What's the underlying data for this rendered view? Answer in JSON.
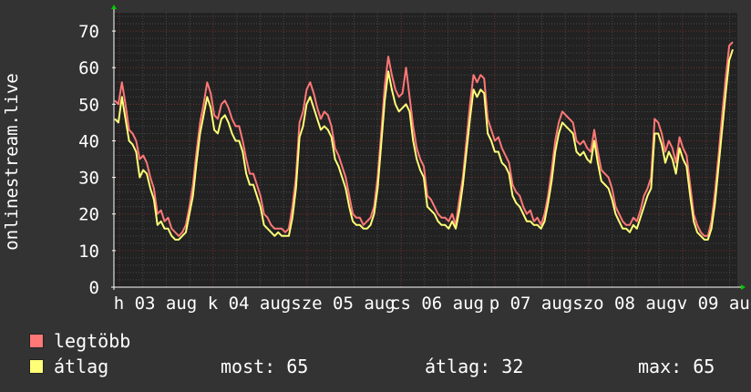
{
  "chart_data": {
    "type": "line",
    "ylabel": "onlinestream.live",
    "ylim": [
      0,
      75
    ],
    "yticks": [
      0,
      10,
      20,
      30,
      40,
      50,
      60,
      70
    ],
    "grid": true,
    "x_ticks": [
      "h 03 aug",
      "k 04 aug",
      "sze 05 aug",
      "cs 06 aug",
      "p 07 aug",
      "szo 08 aug",
      "v 09 aug"
    ],
    "series": [
      {
        "name": "legtöbb",
        "color": "#ff7777",
        "values": [
          51,
          50,
          56,
          50,
          43,
          42,
          40,
          35,
          36,
          34,
          30,
          27,
          20,
          21,
          18,
          19,
          16,
          15,
          14,
          15,
          17,
          22,
          28,
          37,
          45,
          50,
          56,
          53,
          47,
          46,
          50,
          51,
          49,
          46,
          44,
          44,
          40,
          35,
          31,
          31,
          28,
          25,
          20,
          19,
          17,
          16,
          16,
          16,
          15,
          16,
          22,
          30,
          45,
          48,
          54,
          56,
          53,
          49,
          46,
          48,
          47,
          44,
          38,
          36,
          33,
          30,
          25,
          20,
          19,
          19,
          17,
          18,
          19,
          22,
          30,
          42,
          55,
          63,
          58,
          54,
          52,
          53,
          60,
          52,
          44,
          38,
          35,
          33,
          25,
          24,
          22,
          20,
          19,
          19,
          18,
          20,
          17,
          24,
          30,
          40,
          50,
          58,
          56,
          58,
          57,
          46,
          43,
          40,
          41,
          38,
          36,
          34,
          28,
          26,
          25,
          22,
          20,
          21,
          18,
          19,
          17,
          20,
          25,
          32,
          40,
          45,
          48,
          47,
          46,
          45,
          40,
          39,
          40,
          38,
          37,
          43,
          37,
          32,
          31,
          30,
          27,
          22,
          20,
          18,
          17,
          17,
          19,
          18,
          21,
          25,
          27,
          30,
          46,
          45,
          42,
          37,
          40,
          38,
          34,
          41,
          38,
          36,
          28,
          20,
          17,
          15,
          14,
          14,
          18,
          26,
          36,
          47,
          57,
          66,
          67
        ]
      },
      {
        "name": "átlag",
        "color": "#ffff77",
        "values": [
          46,
          45,
          52,
          46,
          40,
          39,
          37,
          30,
          32,
          31,
          27,
          24,
          17,
          18,
          16,
          16,
          14,
          13,
          13,
          14,
          15,
          20,
          25,
          34,
          42,
          47,
          52,
          49,
          43,
          42,
          46,
          47,
          45,
          42,
          40,
          40,
          37,
          31,
          28,
          28,
          25,
          22,
          17,
          16,
          15,
          14,
          15,
          14,
          14,
          14,
          19,
          27,
          41,
          44,
          50,
          52,
          49,
          46,
          43,
          44,
          43,
          41,
          35,
          33,
          30,
          27,
          22,
          18,
          17,
          17,
          16,
          16,
          17,
          20,
          27,
          39,
          51,
          59,
          54,
          50,
          48,
          49,
          50,
          48,
          40,
          35,
          32,
          30,
          22,
          21,
          20,
          18,
          17,
          17,
          16,
          18,
          16,
          21,
          28,
          37,
          46,
          54,
          52,
          54,
          53,
          42,
          40,
          37,
          37,
          34,
          33,
          31,
          25,
          23,
          22,
          20,
          18,
          18,
          17,
          17,
          16,
          18,
          23,
          29,
          37,
          42,
          45,
          44,
          43,
          42,
          37,
          36,
          37,
          35,
          34,
          40,
          34,
          29,
          28,
          27,
          24,
          20,
          18,
          16,
          16,
          15,
          17,
          16,
          19,
          22,
          25,
          27,
          42,
          42,
          39,
          34,
          37,
          35,
          31,
          38,
          35,
          33,
          25,
          18,
          15,
          14,
          13,
          13,
          16,
          23,
          33,
          43,
          53,
          62,
          65
        ]
      }
    ]
  },
  "legend": [
    {
      "label": "legtöbb",
      "color": "#ff7777"
    },
    {
      "label": "átlag",
      "color": "#ffff77"
    }
  ],
  "stats": {
    "most": "most: 65",
    "atlag": "átlag: 32",
    "max": "max: 65"
  },
  "colors": {
    "background": "#333333",
    "plot_background": "#222222",
    "grid_minor": "#4a4a4a",
    "grid_major": "#7a2e2e",
    "axis": "#ffffff",
    "arrow": "#00cc00"
  }
}
